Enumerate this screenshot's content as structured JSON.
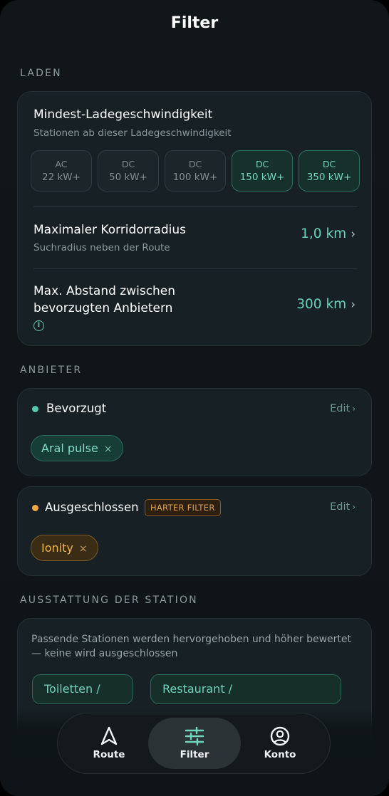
{
  "header": {
    "title": "Filter"
  },
  "sections": {
    "laden": "LADEN",
    "anbieter": "ANBIETER",
    "ausstattung": "AUSSTATTUNG DER STATION"
  },
  "charging": {
    "title": "Mindest-Ladegeschwindigkeit",
    "subtitle": "Stationen ab dieser Ladegeschwindigkeit",
    "options": [
      {
        "type": "AC",
        "power": "22 kW+",
        "selected": false
      },
      {
        "type": "DC",
        "power": "50 kW+",
        "selected": false
      },
      {
        "type": "DC",
        "power": "100 kW+",
        "selected": false
      },
      {
        "type": "DC",
        "power": "150 kW+",
        "selected": true
      },
      {
        "type": "DC",
        "power": "350 kW+",
        "selected": true
      }
    ]
  },
  "corridor": {
    "title": "Maximaler Korridorradius",
    "subtitle": "Suchradius neben der Route",
    "value": "1,0 km",
    "chevron": "›"
  },
  "distance": {
    "title_line1": "Max. Abstand zwischen",
    "title_line2": "bevorzugten Anbietern",
    "value": "300 km",
    "chevron": "›",
    "info_icon": "ⓘ"
  },
  "preferred": {
    "label": "Bevorzugt",
    "edit": "Edit",
    "edit_chevron": "›",
    "dot_color": "#52c8ad",
    "chips": [
      {
        "label": "Aral pulse",
        "remove": "×"
      }
    ]
  },
  "excluded": {
    "label": "Ausgeschlossen",
    "badge": "HARTER FILTER",
    "edit": "Edit",
    "edit_chevron": "›",
    "dot_color": "#f0a841",
    "chips": [
      {
        "label": "Ionity",
        "remove": "×"
      }
    ]
  },
  "amenities": {
    "description_line1": "Passende Stationen werden hervorgehoben und höher bewertet",
    "description_line2": "— keine wird ausgeschlossen",
    "buttons": [
      "Toiletten /",
      "Restaurant /"
    ]
  },
  "navbar": {
    "items": [
      {
        "label": "Route",
        "icon": "navigation-arrow-icon",
        "active": false
      },
      {
        "label": "Filter",
        "icon": "sliders-icon",
        "active": true
      },
      {
        "label": "Konto",
        "icon": "account-circle-icon",
        "active": false
      }
    ]
  },
  "colors": {
    "accent": "#66d0b8",
    "background": "#111619",
    "card": "#172125",
    "warning": "#f0b552"
  }
}
